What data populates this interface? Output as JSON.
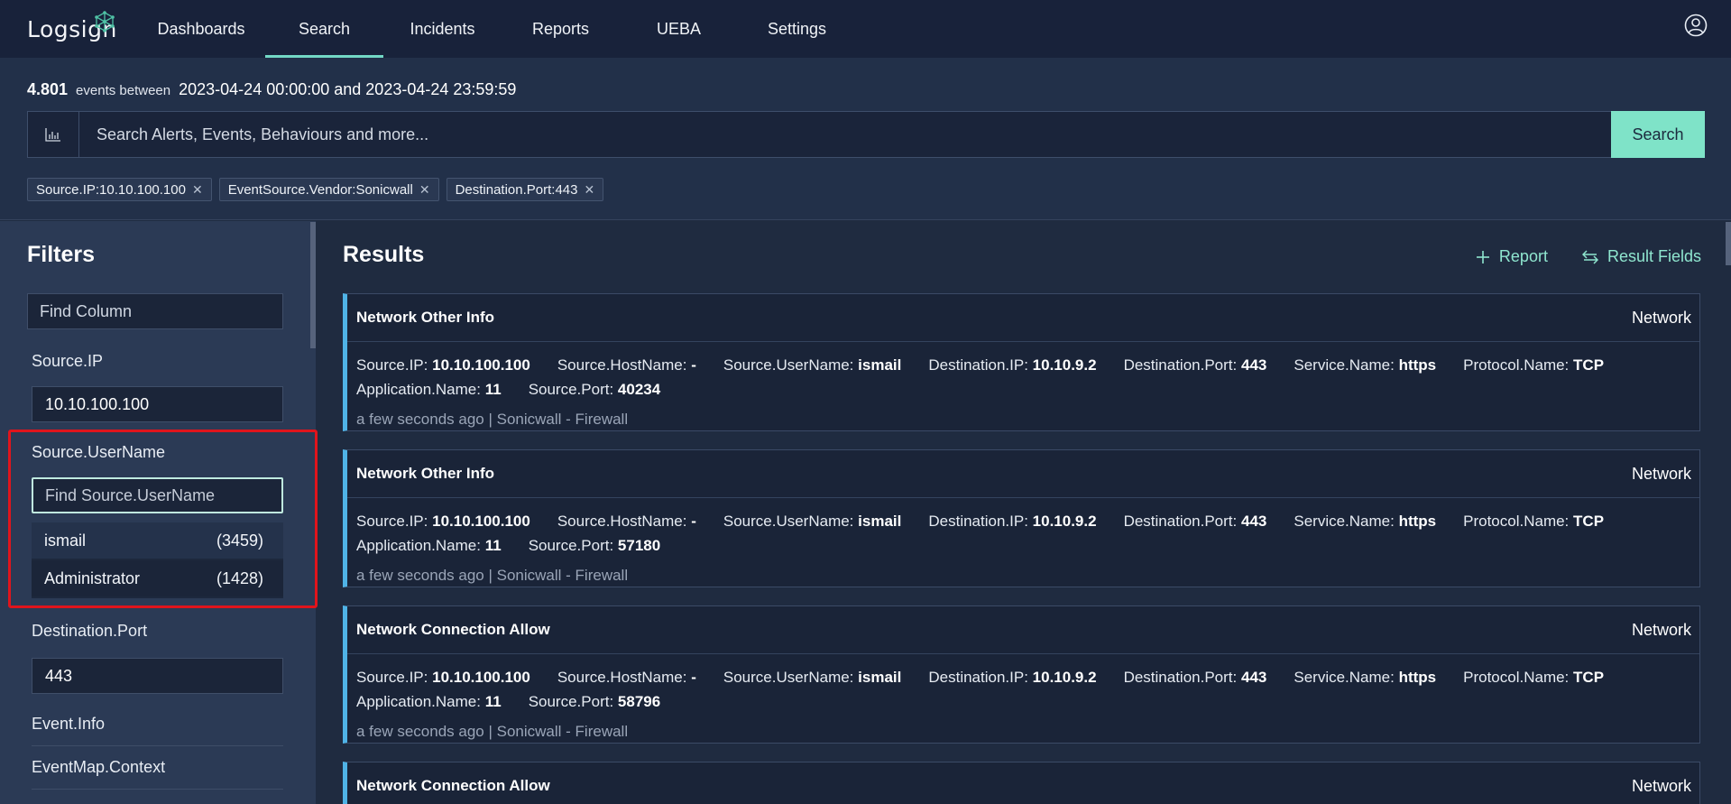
{
  "app": {
    "logo": "Logsign",
    "nav": [
      "Dashboards",
      "Search",
      "Incidents",
      "Reports",
      "UEBA",
      "Settings"
    ],
    "active_nav": "Search"
  },
  "search": {
    "event_count": "4.801",
    "events_between_label": "events between",
    "range": "2023-04-24 00:00:00 and 2023-04-24 23:59:59",
    "placeholder": "Search Alerts, Events, Behaviours and more...",
    "button": "Search",
    "chips": [
      "Source.IP:10.10.100.100",
      "EventSource.Vendor:Sonicwall",
      "Destination.Port:443"
    ]
  },
  "filters": {
    "title": "Filters",
    "find_column_placeholder": "Find Column",
    "source_ip_label": "Source.IP",
    "source_ip_value": "10.10.100.100",
    "username_label": "Source.UserName",
    "username_placeholder": "Find Source.UserName",
    "username_options": [
      {
        "name": "ismail",
        "count": "(3459)"
      },
      {
        "name": "Administrator",
        "count": "(1428)"
      }
    ],
    "dest_port_label": "Destination.Port",
    "dest_port_value": "443",
    "event_info_label": "Event.Info",
    "eventmap_label": "EventMap.Context"
  },
  "results": {
    "title": "Results",
    "report_label": "Report",
    "result_fields_label": "Result Fields",
    "cards": [
      {
        "title": "Network Other Info",
        "category": "Network",
        "row1": [
          [
            "Source.IP:",
            "10.10.100.100"
          ],
          [
            "Source.HostName:",
            "-"
          ],
          [
            "Source.UserName:",
            "ismail"
          ],
          [
            "Destination.IP:",
            "10.10.9.2"
          ],
          [
            "Destination.Port:",
            "443"
          ],
          [
            "Service.Name:",
            "https"
          ],
          [
            "Protocol.Name:",
            "TCP"
          ]
        ],
        "row2": [
          [
            "Application.Name:",
            "11"
          ],
          [
            "Source.Port:",
            "40234"
          ]
        ],
        "meta": "a few seconds ago | Sonicwall - Firewall"
      },
      {
        "title": "Network Other Info",
        "category": "Network",
        "row1": [
          [
            "Source.IP:",
            "10.10.100.100"
          ],
          [
            "Source.HostName:",
            "-"
          ],
          [
            "Source.UserName:",
            "ismail"
          ],
          [
            "Destination.IP:",
            "10.10.9.2"
          ],
          [
            "Destination.Port:",
            "443"
          ],
          [
            "Service.Name:",
            "https"
          ],
          [
            "Protocol.Name:",
            "TCP"
          ]
        ],
        "row2": [
          [
            "Application.Name:",
            "11"
          ],
          [
            "Source.Port:",
            "57180"
          ]
        ],
        "meta": "a few seconds ago | Sonicwall - Firewall"
      },
      {
        "title": "Network Connection Allow",
        "category": "Network",
        "row1": [
          [
            "Source.IP:",
            "10.10.100.100"
          ],
          [
            "Source.HostName:",
            "-"
          ],
          [
            "Source.UserName:",
            "ismail"
          ],
          [
            "Destination.IP:",
            "10.10.9.2"
          ],
          [
            "Destination.Port:",
            "443"
          ],
          [
            "Service.Name:",
            "https"
          ],
          [
            "Protocol.Name:",
            "TCP"
          ]
        ],
        "row2": [
          [
            "Application.Name:",
            "11"
          ],
          [
            "Source.Port:",
            "58796"
          ]
        ],
        "meta": "a few seconds ago | Sonicwall - Firewall"
      },
      {
        "title": "Network Connection Allow",
        "category": "Network",
        "row1": [],
        "row2": [],
        "meta": ""
      }
    ]
  },
  "colors": {
    "accent": "#7fe3c8",
    "card_border": "#4fb3e6",
    "highlight": "#e0141c"
  }
}
